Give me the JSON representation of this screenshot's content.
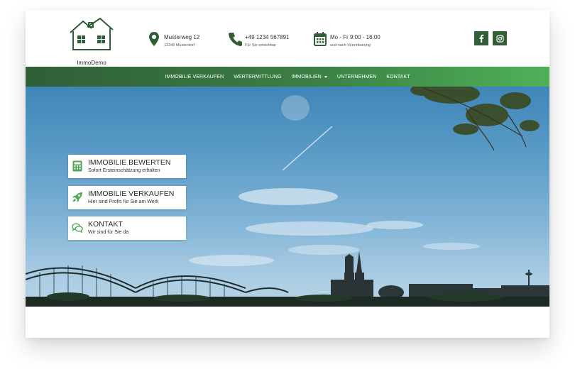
{
  "brand": {
    "name": "ImmoDemo",
    "accent": "#2f5e37",
    "accent_light": "#4fb158"
  },
  "header": {
    "address": {
      "icon": "map-pin-icon",
      "line1": "Musterweg 12",
      "line2": "12345 Musterdorf"
    },
    "phone": {
      "icon": "phone-icon",
      "line1": "+49 1234 567891",
      "line2": "Für Sie erreichbar"
    },
    "hours": {
      "icon": "calendar-icon",
      "line1": "Mo - Fr 9:00 - 16:00",
      "line2": "und nach Vereinbarung"
    },
    "social": [
      {
        "name": "facebook",
        "icon": "facebook-icon"
      },
      {
        "name": "instagram",
        "icon": "instagram-icon"
      }
    ]
  },
  "nav": {
    "items": [
      {
        "label": "IMMOBILIE VERKAUFEN"
      },
      {
        "label": "WERTERMITTLUNG"
      },
      {
        "label": "IMMOBILIEN",
        "has_dropdown": true
      },
      {
        "label": "UNTERNEHMEN"
      },
      {
        "label": "KONTAKT"
      }
    ]
  },
  "hero": {
    "cards": [
      {
        "icon": "calculator-icon",
        "title": "IMMOBILIE BEWERTEN",
        "subtitle": "Sofort Ersteinschätzung erhalten"
      },
      {
        "icon": "rocket-icon",
        "title": "IMMOBILIE VERKAUFEN",
        "subtitle": "Hier sind Profis für Sie am Werk"
      },
      {
        "icon": "chat-icon",
        "title": "KONTAKT",
        "subtitle": "Wir sind für Sie da"
      }
    ]
  }
}
